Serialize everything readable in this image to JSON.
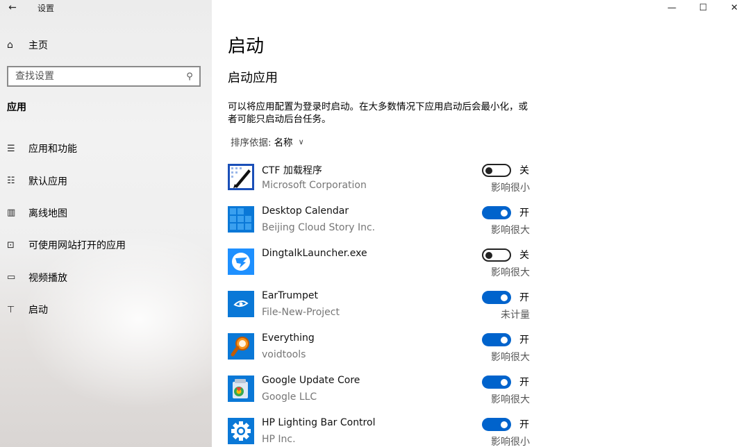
{
  "window": {
    "title": "设置",
    "minimize": "—",
    "maximize": "☐",
    "close": "✕"
  },
  "sidebar": {
    "back": "←",
    "home": {
      "icon": "⌂",
      "label": "主页"
    },
    "search": {
      "placeholder": "查找设置",
      "icon": "⚲"
    },
    "section": "应用",
    "items": [
      {
        "icon": "☰",
        "label": "应用和功能"
      },
      {
        "icon": "☷",
        "label": "默认应用"
      },
      {
        "icon": "▥",
        "label": "离线地图"
      },
      {
        "icon": "⊡",
        "label": "可使用网站打开的应用"
      },
      {
        "icon": "▭",
        "label": "视频播放"
      },
      {
        "icon": "⊤",
        "label": "启动"
      }
    ]
  },
  "main": {
    "title": "启动",
    "subtitle": "启动应用",
    "description": "可以将应用配置为登录时启动。在大多数情况下应用启动后会最小化，或者可能只启动后台任务。",
    "sort_label": "排序依据:",
    "sort_value": "名称",
    "sort_chevron": "∨",
    "apps": [
      {
        "name": "CTF 加载程序",
        "publisher": "Microsoft Corporation",
        "enabled": false,
        "state": "关",
        "impact": "影响很小",
        "icon": "ctf-loader-icon"
      },
      {
        "name": "Desktop Calendar",
        "publisher": "Beijing Cloud Story Inc.",
        "enabled": true,
        "state": "开",
        "impact": "影响很大",
        "icon": "desktop-calendar-icon"
      },
      {
        "name": "DingtalkLauncher.exe",
        "publisher": "",
        "enabled": false,
        "state": "关",
        "impact": "影响很大",
        "icon": "dingtalk-icon"
      },
      {
        "name": "EarTrumpet",
        "publisher": "File-New-Project",
        "enabled": true,
        "state": "开",
        "impact": "未计量",
        "icon": "eartrumpet-icon"
      },
      {
        "name": "Everything",
        "publisher": "voidtools",
        "enabled": true,
        "state": "开",
        "impact": "影响很大",
        "icon": "everything-icon"
      },
      {
        "name": "Google Update Core",
        "publisher": "Google LLC",
        "enabled": true,
        "state": "开",
        "impact": "影响很大",
        "icon": "google-update-icon"
      },
      {
        "name": "HP Lighting Bar Control",
        "publisher": "HP Inc.",
        "enabled": true,
        "state": "开",
        "impact": "影响很小",
        "icon": "hp-gear-icon"
      }
    ]
  },
  "colors": {
    "accent": "#0063cc",
    "secondary_text": "#767676"
  }
}
